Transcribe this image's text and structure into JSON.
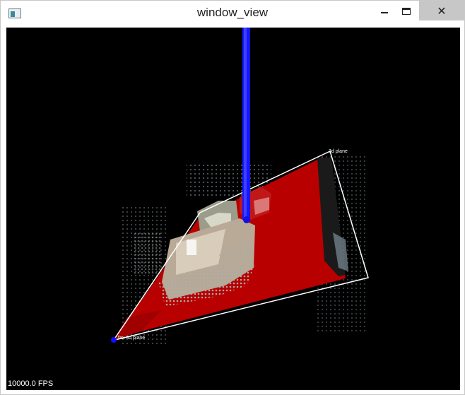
{
  "window": {
    "title": "window_view",
    "close_glyph": "✕"
  },
  "viewport": {
    "fps_label": "10000.0 FPS",
    "plane_label_near": "fax 3d plane",
    "plane_label_far": "3d plane",
    "colors": {
      "background": "#000000",
      "plane": "#b80000",
      "axis": "#1010ff",
      "outline": "#ffffff"
    }
  },
  "icons": {
    "app": "app-window-icon",
    "minimize": "minimize-icon",
    "maximize": "maximize-icon",
    "close": "close-icon"
  }
}
